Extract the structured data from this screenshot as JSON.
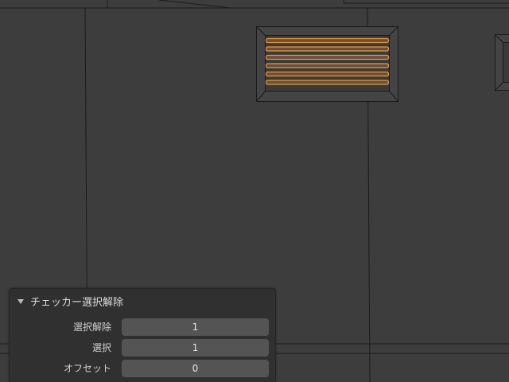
{
  "operator_panel": {
    "title": "チェッカー選択解除",
    "fields": [
      {
        "label": "選択解除",
        "value": "1"
      },
      {
        "label": "選択",
        "value": "1"
      },
      {
        "label": "オフセット",
        "value": "0"
      }
    ]
  },
  "colors": {
    "viewport_bg": "#3d3d3d",
    "wire": "#1a1a1a",
    "selected_edge": "#e8963c",
    "panel_bg": "#303030",
    "field_bg": "#545454"
  }
}
